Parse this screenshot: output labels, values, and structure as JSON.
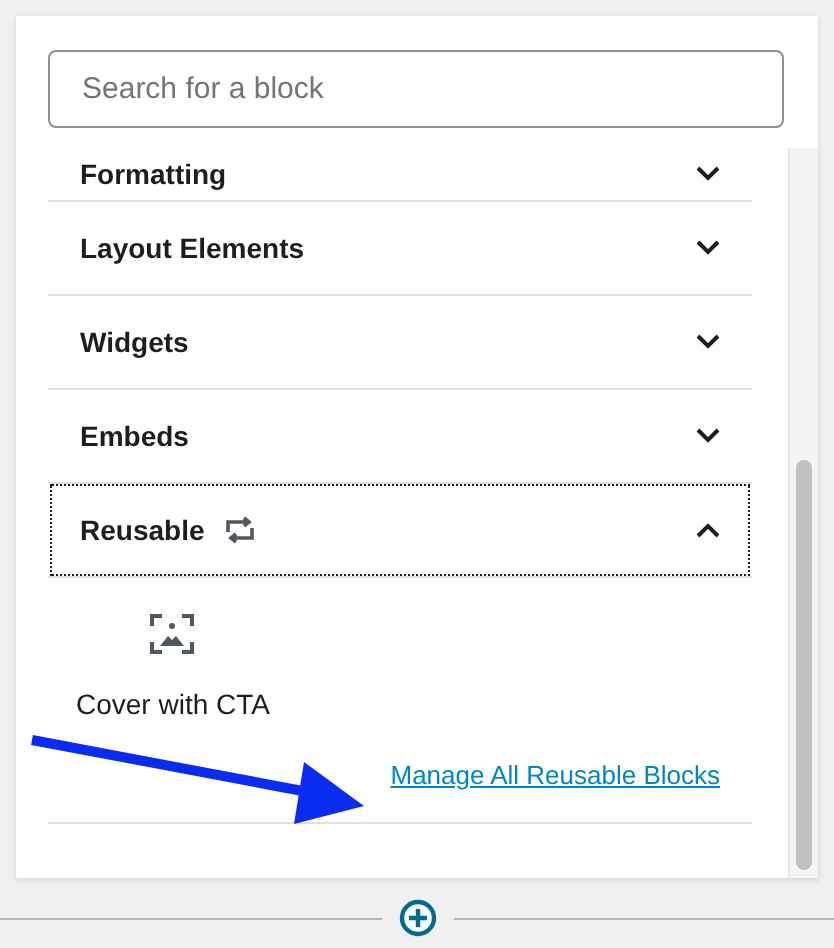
{
  "search": {
    "placeholder": "Search for a block"
  },
  "categories": [
    {
      "label": "Formatting",
      "kind": "plain",
      "expanded": false,
      "focused": false
    },
    {
      "label": "Layout Elements",
      "kind": "plain",
      "expanded": false,
      "focused": false
    },
    {
      "label": "Widgets",
      "kind": "plain",
      "expanded": false,
      "focused": false
    },
    {
      "label": "Embeds",
      "kind": "plain",
      "expanded": false,
      "focused": false
    },
    {
      "label": "Reusable",
      "kind": "reusable",
      "expanded": true,
      "focused": true,
      "blocks": [
        {
          "label": "Cover with CTA"
        }
      ],
      "link": "Manage All Reusable Blocks"
    }
  ]
}
